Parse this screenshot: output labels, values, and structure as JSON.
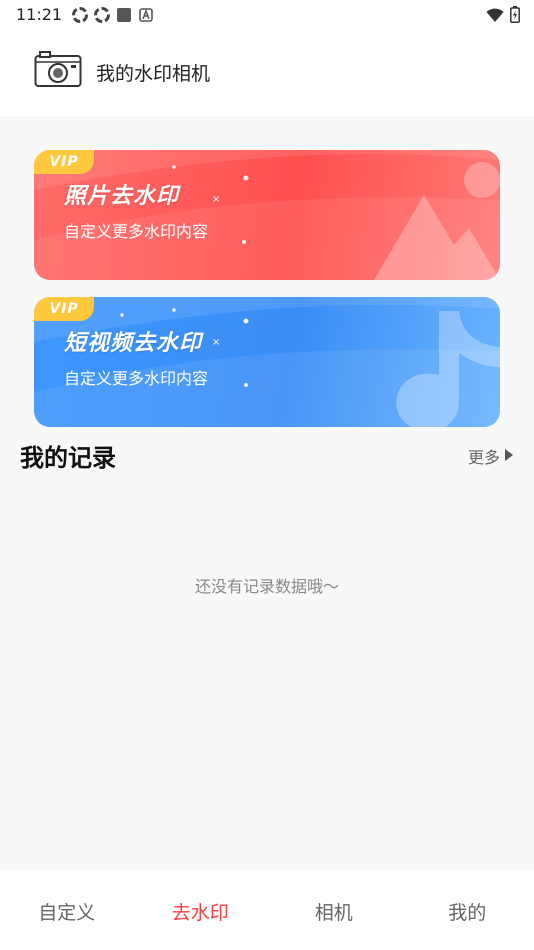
{
  "status_bar": {
    "time": "11:21",
    "icons": [
      "sync-icon",
      "sync-icon",
      "square-icon",
      "a-badge-icon"
    ],
    "right_icons": [
      "wifi-icon",
      "battery-icon"
    ]
  },
  "header": {
    "icon": "camera-icon",
    "title": "我的水印相机"
  },
  "banners": [
    {
      "badge": "VIP",
      "title": "照片去水印",
      "subtitle": "自定义更多水印内容",
      "color": "#ff5a5a",
      "art_icon": "mountain-icon"
    },
    {
      "badge": "VIP",
      "title": "短视频去水印",
      "subtitle": "自定义更多水印内容",
      "color": "#3a8df5",
      "art_icon": "music-note-icon"
    }
  ],
  "records": {
    "title": "我的记录",
    "more_label": "更多",
    "empty_message": "还没有记录数据哦～"
  },
  "bottom_nav": {
    "items": [
      {
        "label": "自定义"
      },
      {
        "label": "去水印"
      },
      {
        "label": "相机"
      },
      {
        "label": "我的"
      }
    ],
    "active_index": 1,
    "active_color": "#ff3b3b"
  }
}
